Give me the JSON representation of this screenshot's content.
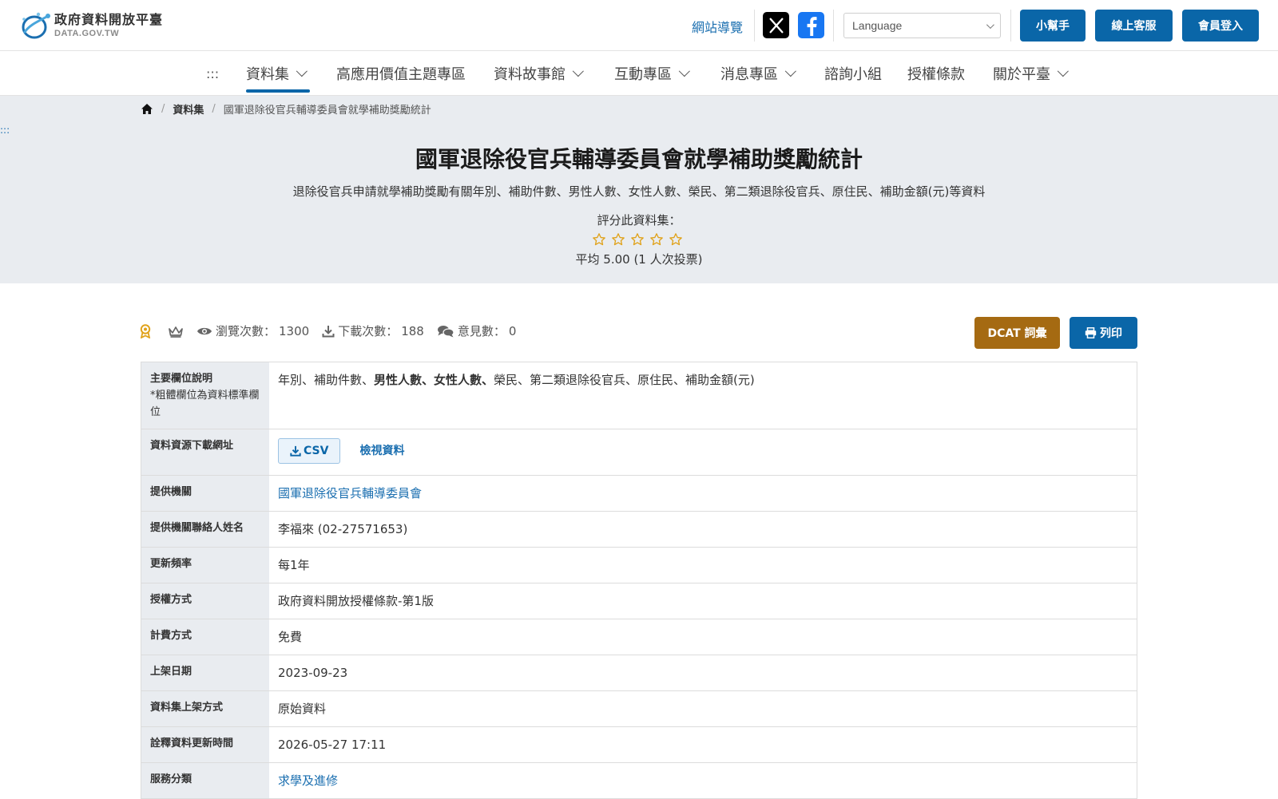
{
  "header": {
    "logo_title": "政府資料開放平臺",
    "logo_sub": "DATA.GOV.TW",
    "sitemap": "網站導覽",
    "language_placeholder": "Language",
    "buttons": {
      "helper": "小幫手",
      "support": "線上客服",
      "login": "會員登入"
    }
  },
  "nav": {
    "accesskey": ":::",
    "items": [
      "資料集",
      "高應用價值主題專區",
      "資料故事館",
      "互動專區",
      "消息專區",
      "諮詢小組",
      "授權條款",
      "關於平臺"
    ]
  },
  "breadcrumb": {
    "level1": "資料集",
    "current": "國軍退除役官兵輔導委員會就學補助獎勵統計"
  },
  "hero": {
    "accesskey": ":::",
    "title": "國軍退除役官兵輔導委員會就學補助獎勵統計",
    "description": "退除役官兵申請就學補助獎勵有關年別、補助件數、男性人數、女性人數、榮民、第二類退除役官兵、原住民、補助金額(元)等資料",
    "rating_label": "評分此資料集：",
    "rating_avg": "平均 5.00 (1 人次投票)",
    "stars": 5
  },
  "stats": {
    "views_label": "瀏覽次數：",
    "views": "1300",
    "downloads_label": "下載次數：",
    "downloads": "188",
    "comments_label": "意見數：",
    "comments": "0",
    "dcat": "DCAT 詞彙",
    "print": "列印"
  },
  "table": {
    "fields": {
      "label": "主要欄位說明",
      "note": "*粗體欄位為資料標準欄位",
      "part1": "年別、補助件數、",
      "bold": "男性人數、女性人數、",
      "part2": "榮民、第二類退除役官兵、原住民、補助金額(元)"
    },
    "download": {
      "label": "資料資源下載網址",
      "csv": "CSV",
      "view": "檢視資料"
    },
    "rows": [
      {
        "label": "提供機關",
        "value": "國軍退除役官兵輔導委員會"
      },
      {
        "label": "提供機關聯絡人姓名",
        "value": "李福來 (02-27571653)"
      },
      {
        "label": "更新頻率",
        "value": "每1年"
      },
      {
        "label": "授權方式",
        "value": "政府資料開放授權條款-第1版"
      },
      {
        "label": "計費方式",
        "value": "免費"
      },
      {
        "label": "上架日期",
        "value": "2023-09-23"
      },
      {
        "label": "資料集上架方式",
        "value": "原始資料"
      },
      {
        "label": "詮釋資料更新時間",
        "value": "2026-05-27 17:11"
      },
      {
        "label": "服務分類",
        "value": "求學及進修"
      }
    ]
  },
  "colors": {
    "primary": "#0a66a8",
    "dcat": "#a56a12",
    "hero_bg": "#e9ecf0",
    "star": "#e0a21a"
  }
}
